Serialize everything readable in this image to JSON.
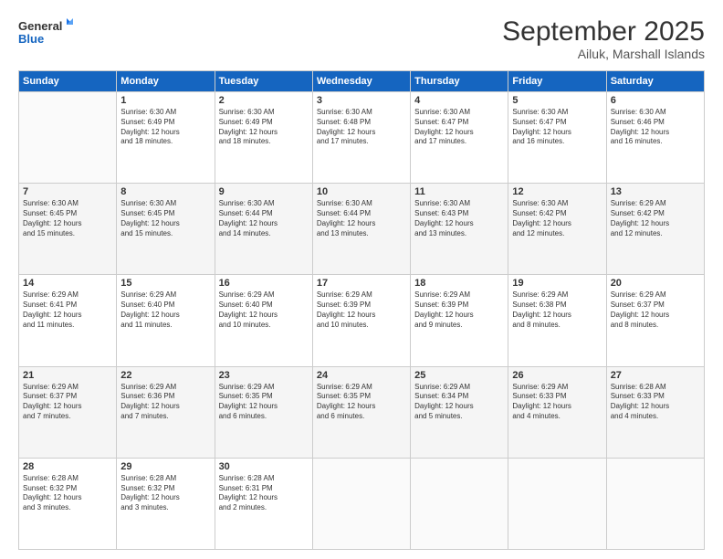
{
  "logo": {
    "line1": "General",
    "line2": "Blue"
  },
  "header": {
    "month": "September 2025",
    "location": "Ailuk, Marshall Islands"
  },
  "weekdays": [
    "Sunday",
    "Monday",
    "Tuesday",
    "Wednesday",
    "Thursday",
    "Friday",
    "Saturday"
  ],
  "weeks": [
    [
      {
        "day": "",
        "info": ""
      },
      {
        "day": "1",
        "info": "Sunrise: 6:30 AM\nSunset: 6:49 PM\nDaylight: 12 hours\nand 18 minutes."
      },
      {
        "day": "2",
        "info": "Sunrise: 6:30 AM\nSunset: 6:49 PM\nDaylight: 12 hours\nand 18 minutes."
      },
      {
        "day": "3",
        "info": "Sunrise: 6:30 AM\nSunset: 6:48 PM\nDaylight: 12 hours\nand 17 minutes."
      },
      {
        "day": "4",
        "info": "Sunrise: 6:30 AM\nSunset: 6:47 PM\nDaylight: 12 hours\nand 17 minutes."
      },
      {
        "day": "5",
        "info": "Sunrise: 6:30 AM\nSunset: 6:47 PM\nDaylight: 12 hours\nand 16 minutes."
      },
      {
        "day": "6",
        "info": "Sunrise: 6:30 AM\nSunset: 6:46 PM\nDaylight: 12 hours\nand 16 minutes."
      }
    ],
    [
      {
        "day": "7",
        "info": "Sunrise: 6:30 AM\nSunset: 6:45 PM\nDaylight: 12 hours\nand 15 minutes."
      },
      {
        "day": "8",
        "info": "Sunrise: 6:30 AM\nSunset: 6:45 PM\nDaylight: 12 hours\nand 15 minutes."
      },
      {
        "day": "9",
        "info": "Sunrise: 6:30 AM\nSunset: 6:44 PM\nDaylight: 12 hours\nand 14 minutes."
      },
      {
        "day": "10",
        "info": "Sunrise: 6:30 AM\nSunset: 6:44 PM\nDaylight: 12 hours\nand 13 minutes."
      },
      {
        "day": "11",
        "info": "Sunrise: 6:30 AM\nSunset: 6:43 PM\nDaylight: 12 hours\nand 13 minutes."
      },
      {
        "day": "12",
        "info": "Sunrise: 6:30 AM\nSunset: 6:42 PM\nDaylight: 12 hours\nand 12 minutes."
      },
      {
        "day": "13",
        "info": "Sunrise: 6:29 AM\nSunset: 6:42 PM\nDaylight: 12 hours\nand 12 minutes."
      }
    ],
    [
      {
        "day": "14",
        "info": "Sunrise: 6:29 AM\nSunset: 6:41 PM\nDaylight: 12 hours\nand 11 minutes."
      },
      {
        "day": "15",
        "info": "Sunrise: 6:29 AM\nSunset: 6:40 PM\nDaylight: 12 hours\nand 11 minutes."
      },
      {
        "day": "16",
        "info": "Sunrise: 6:29 AM\nSunset: 6:40 PM\nDaylight: 12 hours\nand 10 minutes."
      },
      {
        "day": "17",
        "info": "Sunrise: 6:29 AM\nSunset: 6:39 PM\nDaylight: 12 hours\nand 10 minutes."
      },
      {
        "day": "18",
        "info": "Sunrise: 6:29 AM\nSunset: 6:39 PM\nDaylight: 12 hours\nand 9 minutes."
      },
      {
        "day": "19",
        "info": "Sunrise: 6:29 AM\nSunset: 6:38 PM\nDaylight: 12 hours\nand 8 minutes."
      },
      {
        "day": "20",
        "info": "Sunrise: 6:29 AM\nSunset: 6:37 PM\nDaylight: 12 hours\nand 8 minutes."
      }
    ],
    [
      {
        "day": "21",
        "info": "Sunrise: 6:29 AM\nSunset: 6:37 PM\nDaylight: 12 hours\nand 7 minutes."
      },
      {
        "day": "22",
        "info": "Sunrise: 6:29 AM\nSunset: 6:36 PM\nDaylight: 12 hours\nand 7 minutes."
      },
      {
        "day": "23",
        "info": "Sunrise: 6:29 AM\nSunset: 6:35 PM\nDaylight: 12 hours\nand 6 minutes."
      },
      {
        "day": "24",
        "info": "Sunrise: 6:29 AM\nSunset: 6:35 PM\nDaylight: 12 hours\nand 6 minutes."
      },
      {
        "day": "25",
        "info": "Sunrise: 6:29 AM\nSunset: 6:34 PM\nDaylight: 12 hours\nand 5 minutes."
      },
      {
        "day": "26",
        "info": "Sunrise: 6:29 AM\nSunset: 6:33 PM\nDaylight: 12 hours\nand 4 minutes."
      },
      {
        "day": "27",
        "info": "Sunrise: 6:28 AM\nSunset: 6:33 PM\nDaylight: 12 hours\nand 4 minutes."
      }
    ],
    [
      {
        "day": "28",
        "info": "Sunrise: 6:28 AM\nSunset: 6:32 PM\nDaylight: 12 hours\nand 3 minutes."
      },
      {
        "day": "29",
        "info": "Sunrise: 6:28 AM\nSunset: 6:32 PM\nDaylight: 12 hours\nand 3 minutes."
      },
      {
        "day": "30",
        "info": "Sunrise: 6:28 AM\nSunset: 6:31 PM\nDaylight: 12 hours\nand 2 minutes."
      },
      {
        "day": "",
        "info": ""
      },
      {
        "day": "",
        "info": ""
      },
      {
        "day": "",
        "info": ""
      },
      {
        "day": "",
        "info": ""
      }
    ]
  ]
}
